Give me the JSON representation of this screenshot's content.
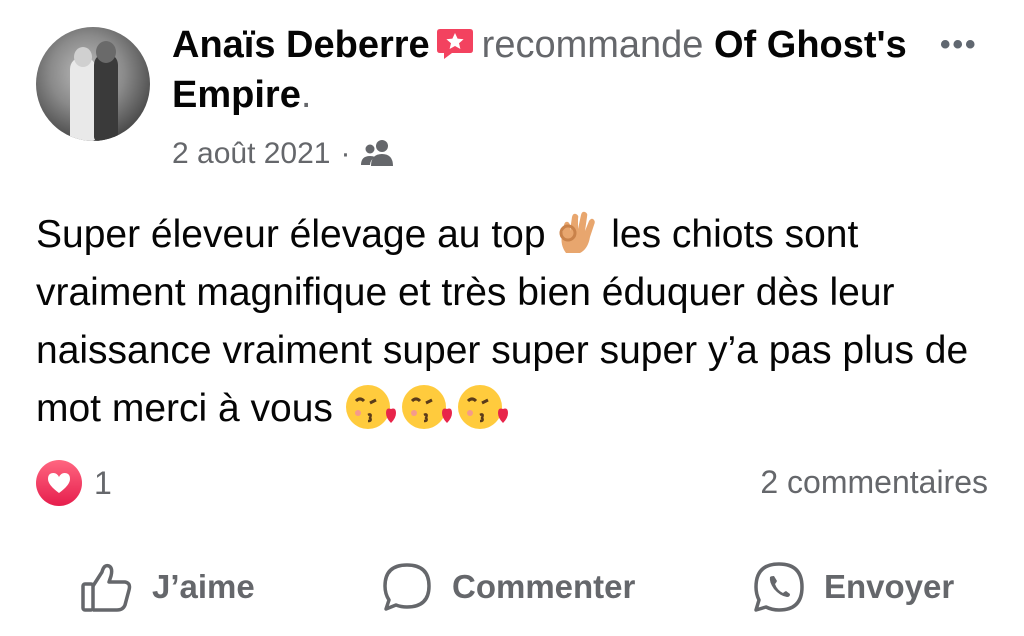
{
  "post": {
    "author": "Anaïs Deberre",
    "recommends_text": "recommande",
    "page_name": "Of Ghost's Empire",
    "period": ".",
    "date": "2 août 2021",
    "separator": "·",
    "body": {
      "part1": "Super éleveur élevage au top ",
      "part2": " les chiots sont vraiment magnifique et très bien éduquer dès leur naissance vraiment super super super y’a pas plus de mot merci à vous "
    },
    "reaction_count": "1",
    "comments": "2 commentaires"
  },
  "actions": {
    "like": "J’aime",
    "comment": "Commenter",
    "send": "Envoyer"
  },
  "icons": {
    "recommend_badge": "recommendation-star-icon",
    "audience": "friends-audience-icon",
    "more": "more-options-icon",
    "reaction": "heart-reaction-icon"
  },
  "colors": {
    "recommend_badge": "#f3425f",
    "secondary_text": "#65676b",
    "heart": "#f33e58"
  }
}
